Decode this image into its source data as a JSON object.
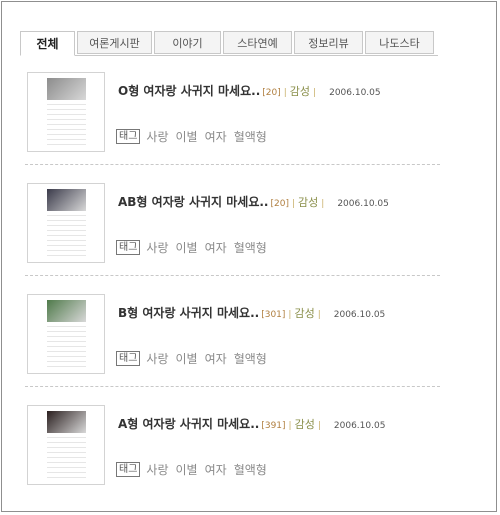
{
  "tabs": [
    "전체",
    "여론게시판",
    "이야기",
    "스타연예",
    "정보리뷰",
    "나도스타"
  ],
  "posts": [
    {
      "title": "O형 여자랑 사귀지 마세요..",
      "count": "[20]",
      "category": "감성",
      "date": "2006.10.05",
      "tag_label": "태그",
      "tags": [
        "사랑",
        "이별",
        "여자",
        "혈액형"
      ],
      "photo_color": "#8c8c8c"
    },
    {
      "title": "AB형 여자랑 사귀지 마세요..",
      "count": "[20]",
      "category": "감성",
      "date": "2006.10.05",
      "tag_label": "태그",
      "tags": [
        "사랑",
        "이별",
        "여자",
        "혈액형"
      ],
      "photo_color": "#3a3a4a"
    },
    {
      "title": "B형 여자랑 사귀지 마세요..",
      "count": "[301]",
      "category": "감성",
      "date": "2006.10.05",
      "tag_label": "태그",
      "tags": [
        "사랑",
        "이별",
        "여자",
        "혈액형"
      ],
      "photo_color": "#4f7a4a"
    },
    {
      "title": "A형 여자랑 사귀지 마세요..",
      "count": "[391]",
      "category": "감성",
      "date": "2006.10.05",
      "tag_label": "태그",
      "tags": [
        "사랑",
        "이별",
        "여자",
        "혈액형"
      ],
      "photo_color": "#2a1f1f"
    }
  ]
}
